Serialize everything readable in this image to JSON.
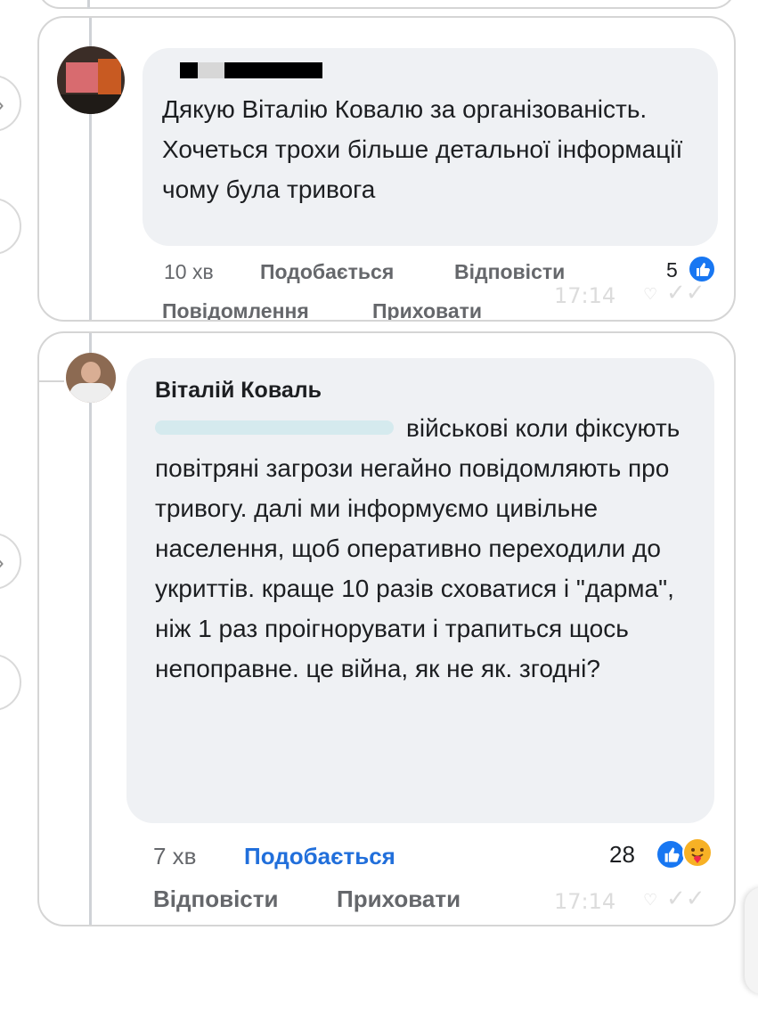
{
  "comment1": {
    "text": "Дякую Віталію Ковалю за організованість. Хочеться трохи більше детальної інформації чому була тривога",
    "time": "10 хв",
    "like_label": "Подобається",
    "reply_label": "Відповісти",
    "message_label": "Повідомлення",
    "hide_label": "Приховати",
    "reaction_count": "5",
    "timestamp": "17:14"
  },
  "comment2": {
    "author": "Віталій Коваль",
    "text": "військові коли фіксують повітряні загрози негайно повідомляють про тривогу. далі ми інформуємо цивільне населення, щоб оперативно переходили до укриттів. краще 10 разів сховатися і \"дарма\", ніж 1 раз проігнорувати і трапиться щось непоправне. це війна, як не як. згодні?",
    "time": "7 хв",
    "like_label": "Подобається",
    "reply_label": "Відповісти",
    "hide_label": "Приховати",
    "reaction_count": "28",
    "timestamp": "17:14"
  },
  "colors": {
    "like_blue": "#216fdb",
    "bubble_bg": "#eff1f4",
    "meta_gray": "#65676b"
  },
  "icons": [
    "chevron-right-icon",
    "like-reaction-icon",
    "care-reaction-icon",
    "heart-icon",
    "double-check-icon"
  ]
}
